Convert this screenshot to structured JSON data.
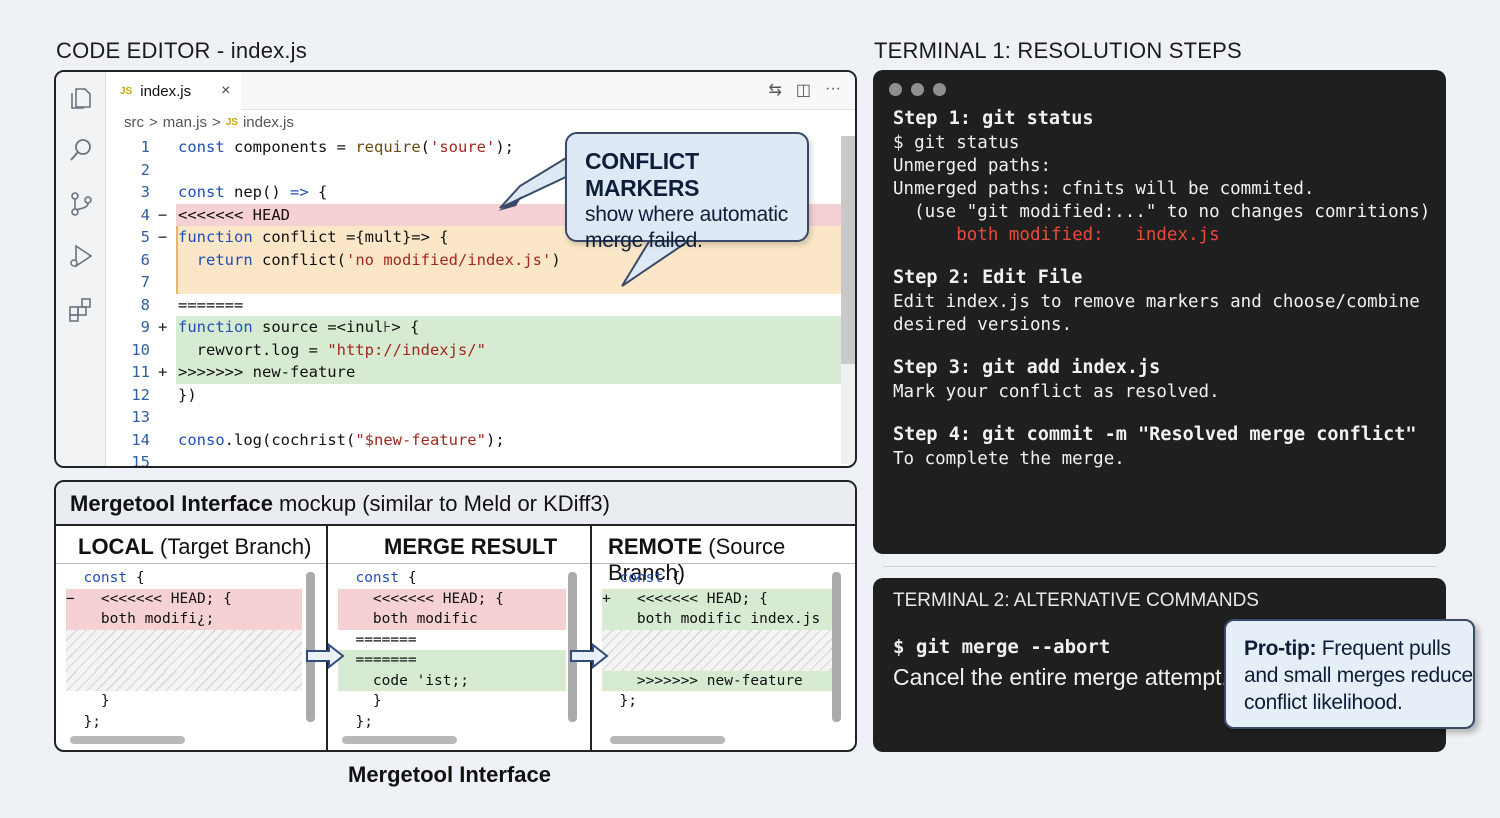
{
  "editor": {
    "section_title": "CODE EDITOR - index.js",
    "tab": {
      "badge": "JS",
      "filename": "index.js",
      "close": "×"
    },
    "actions": [
      "⇆",
      "◫",
      "···"
    ],
    "breadcrumb": {
      "folder": "src",
      "sep": ">",
      "file1": "man.js",
      "badge": "JS",
      "file2": "index.js"
    },
    "callout": {
      "title": "CONFLICT MARKERS",
      "line1": "show where automatic",
      "line2": "merge failed."
    }
  },
  "code_lines": [
    {
      "n": "1",
      "mark": "",
      "bg": "",
      "tokens": [
        [
          "kw",
          "const"
        ],
        [
          "",
          "components = "
        ],
        [
          "fn",
          "require"
        ],
        [
          "",
          "("
        ],
        [
          "str",
          "'soure'"
        ],
        [
          "",
          ");"
        ]
      ]
    },
    {
      "n": "2",
      "mark": "",
      "bg": "",
      "tokens": []
    },
    {
      "n": "3",
      "mark": "",
      "bg": "",
      "tokens": [
        [
          "kw",
          "const"
        ],
        [
          "",
          "nep() "
        ],
        [
          "kw",
          "=>"
        ],
        [
          "",
          " {"
        ]
      ]
    },
    {
      "n": "4",
      "mark": "−",
      "bg": "red",
      "tokens": [
        [
          "",
          "<<<<<<< HEAD"
        ]
      ]
    },
    {
      "n": "5",
      "mark": "−",
      "bg": "orange",
      "tokens": [
        [
          "kw",
          "function"
        ],
        [
          "",
          " conflict ={mult}=> {"
        ]
      ]
    },
    {
      "n": "6",
      "mark": "",
      "bg": "orange",
      "tokens": [
        [
          "",
          "  "
        ],
        [
          "kw",
          "return"
        ],
        [
          "",
          " conflict("
        ],
        [
          "str",
          "'no modified/index.js'"
        ],
        [
          "",
          ")"
        ]
      ]
    },
    {
      "n": "7",
      "mark": "",
      "bg": "orange",
      "tokens": []
    },
    {
      "n": "8",
      "mark": "",
      "bg": "",
      "tokens": [
        [
          "",
          "======="
        ]
      ]
    },
    {
      "n": "9",
      "mark": "+",
      "bg": "green",
      "tokens": [
        [
          "kw",
          "function"
        ],
        [
          "",
          " source =<inul⊦> {"
        ]
      ]
    },
    {
      "n": "10",
      "mark": "",
      "bg": "green",
      "tokens": [
        [
          "",
          "  rewvort.log = "
        ],
        [
          "str",
          "\"http://indexjs/\""
        ]
      ]
    },
    {
      "n": "11",
      "mark": "+",
      "bg": "green",
      "tokens": [
        [
          "",
          ">>>>>>> new-feature"
        ]
      ]
    },
    {
      "n": "12",
      "mark": "",
      "bg": "",
      "tokens": [
        [
          "",
          "})"
        ]
      ]
    },
    {
      "n": "13",
      "mark": "",
      "bg": "",
      "tokens": []
    },
    {
      "n": "14",
      "mark": "",
      "bg": "",
      "tokens": [
        [
          "kw",
          "conso"
        ],
        [
          "",
          ".log(cochrist("
        ],
        [
          "str",
          "\"$new-feature\""
        ],
        [
          "",
          ");"
        ]
      ]
    },
    {
      "n": "15",
      "mark": "",
      "bg": "",
      "tokens": []
    }
  ],
  "mergetool": {
    "header_bold": "Mergetool Interface",
    "header_rest": " mockup (similar to Meld or KDiff3)",
    "caption": "Mergetool Interface",
    "local": {
      "title_bold": "LOCAL",
      "title_rest": " (Target Branch)",
      "lines": [
        {
          "text": "  const {",
          "bg": ""
        },
        {
          "text": "−   <<<<<<< HEAD; {",
          "bg": "red"
        },
        {
          "text": "    both modifi¿;",
          "bg": "red"
        },
        {
          "text": "",
          "bg": "hatch"
        },
        {
          "text": "",
          "bg": "hatch"
        },
        {
          "text": "",
          "bg": "hatch"
        },
        {
          "text": "    }",
          "bg": ""
        },
        {
          "text": "  };",
          "bg": ""
        }
      ]
    },
    "merge": {
      "title_bold": "MERGE RESULT",
      "title_rest": "",
      "lines": [
        {
          "text": "  const {",
          "bg": ""
        },
        {
          "text": "    <<<<<<< HEAD; {",
          "bg": "red"
        },
        {
          "text": "    both modific",
          "bg": "red"
        },
        {
          "text": "  =======",
          "bg": ""
        },
        {
          "text": "  =======",
          "bg": "green"
        },
        {
          "text": "    code 'ist;;",
          "bg": "green"
        },
        {
          "text": "    }",
          "bg": ""
        },
        {
          "text": "  };",
          "bg": ""
        }
      ]
    },
    "remote": {
      "title_bold": "REMOTE",
      "title_rest": " (Source Branch)",
      "lines": [
        {
          "text": "  const {",
          "bg": ""
        },
        {
          "text": "+   <<<<<<< HEAD; {",
          "bg": "green"
        },
        {
          "text": "    both modific index.js",
          "bg": "green"
        },
        {
          "text": "",
          "bg": "hatch"
        },
        {
          "text": "",
          "bg": "hatch"
        },
        {
          "text": "    >>>>>>> new-feature",
          "bg": "green"
        },
        {
          "text": "  };",
          "bg": ""
        }
      ]
    }
  },
  "terminal1": {
    "section_title": "TERMINAL 1: RESOLUTION STEPS",
    "step1_title": "Step 1: git status",
    "step1_lines": [
      "$ git status",
      "Unmerged paths:",
      "Unmerged paths: cfnits will be commited.",
      "  (use \"git modified:...\" to no changes comritions)"
    ],
    "step1_red": "      both modified:   index.js",
    "step2_title": "Step 2: Edit File",
    "step2_lines": [
      "Edit index.js to remove markers and choose/combine",
      "desired versions."
    ],
    "step3_title": "Step 3: git add index.js",
    "step3_lines": [
      "Mark your conflict as resolved."
    ],
    "step4_title": "Step 4: git commit -m \"Resolved merge conflict\"",
    "step4_lines": [
      "To complete the merge."
    ]
  },
  "terminal2": {
    "title": "TERMINAL 2: ALTERNATIVE COMMANDS",
    "command": "$ git merge --abort",
    "description": "Cancel the entire merge attempt."
  },
  "protip": {
    "bold": "Pro-tip:",
    "rest": " Frequent pulls and small merges reduce conflict likelihood."
  },
  "colors": {
    "conflict_red": "#f6d1d3",
    "conflict_orange": "#fbe7c8",
    "incoming_green": "#d7ebd2",
    "terminal_bg": "#1f1f1f",
    "terminal_error": "#e84a3c",
    "keyword": "#1f4fb5",
    "string": "#a3281c"
  },
  "icons": [
    "files-icon",
    "search-icon",
    "source-control-icon",
    "run-debug-icon",
    "extensions-icon",
    "compare-icon",
    "split-editor-icon",
    "more-icon",
    "arrow-right-icon"
  ]
}
